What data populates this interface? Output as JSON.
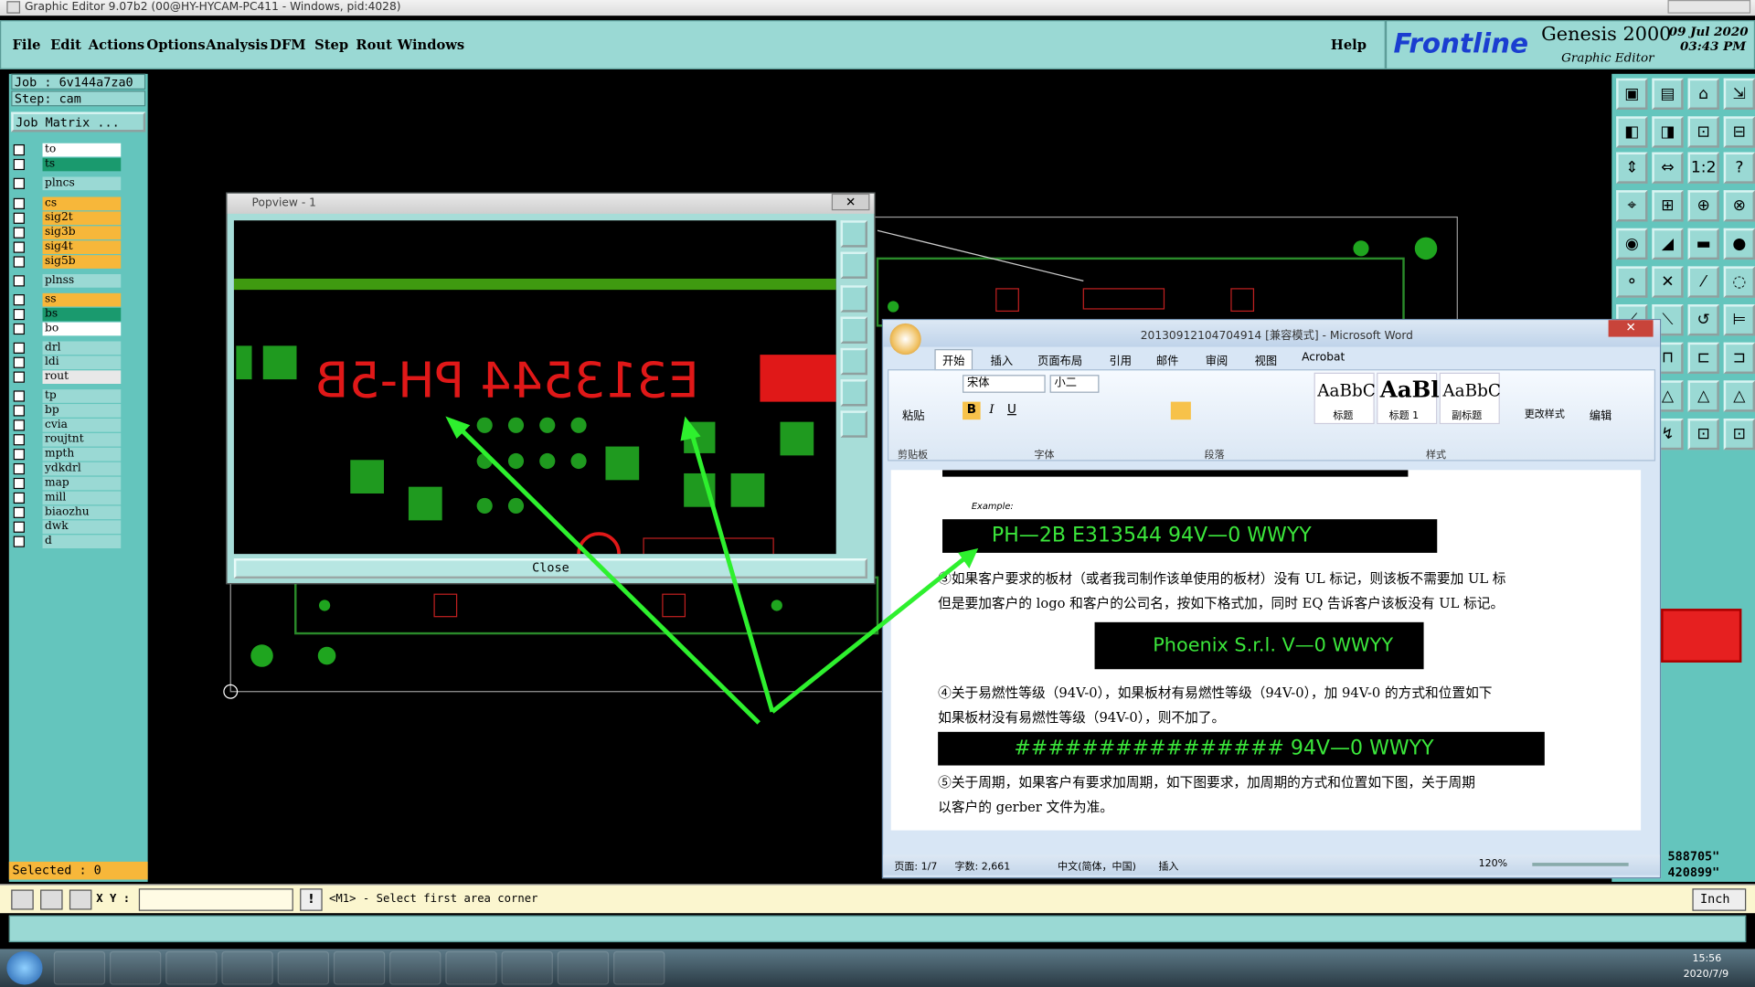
{
  "window": {
    "title": "Graphic Editor 9.07b2 (00@HY-HYCAM-PC411 - Windows, pid:4028)"
  },
  "menu": {
    "items": [
      "File",
      "Edit",
      "Actions",
      "Options",
      "Analysis",
      "DFM",
      "Step",
      "Rout",
      "Windows"
    ],
    "help": "Help"
  },
  "brand": {
    "logo": "Frontline",
    "product": "Genesis 2000",
    "subtitle": "Graphic Editor",
    "date": "09 Jul 2020",
    "time": "03:43 PM"
  },
  "job": {
    "job_line": "Job : 6v144a7za0",
    "step_line": "Step: cam",
    "matrix_button": "Job Matrix ..."
  },
  "layers": [
    {
      "name": "to",
      "color": "#ffffff"
    },
    {
      "name": "ts",
      "color": "#1a9a6e"
    },
    {
      "name": "plncs",
      "color": "#9ad9d4"
    },
    {
      "name": "cs",
      "color": "#f7b73a"
    },
    {
      "name": "sig2t",
      "color": "#f7b73a"
    },
    {
      "name": "sig3b",
      "color": "#f7b73a"
    },
    {
      "name": "sig4t",
      "color": "#f7b73a"
    },
    {
      "name": "sig5b",
      "color": "#f7b73a"
    },
    {
      "name": "plnss",
      "color": "#9ad9d4"
    },
    {
      "name": "ss",
      "color": "#f7b73a"
    },
    {
      "name": "bs",
      "color": "#1a9a6e"
    },
    {
      "name": "bo",
      "color": "#ffffff"
    },
    {
      "name": "drl",
      "color": "#9ad9d4"
    },
    {
      "name": "ldi",
      "color": "#9ad9d4"
    },
    {
      "name": "rout",
      "color": "#e8e8e8"
    },
    {
      "name": "tp",
      "color": "#9ad9d4"
    },
    {
      "name": "bp",
      "color": "#9ad9d4"
    },
    {
      "name": "cvia",
      "color": "#9ad9d4"
    },
    {
      "name": "roujtnt",
      "color": "#9ad9d4"
    },
    {
      "name": "mpth",
      "color": "#9ad9d4"
    },
    {
      "name": "ydkdrl",
      "color": "#9ad9d4"
    },
    {
      "name": "map",
      "color": "#9ad9d4"
    },
    {
      "name": "mill",
      "color": "#9ad9d4"
    },
    {
      "name": "biaozhu",
      "color": "#9ad9d4"
    },
    {
      "name": "dwk",
      "color": "#9ad9d4"
    },
    {
      "name": "d",
      "color": "#9ad9d4"
    }
  ],
  "selected": "Selected : 0",
  "status": {
    "xy_label": "X Y :",
    "prompt": "<M1> - Select first area corner",
    "unit": "Inch",
    "coord1": "588705\"",
    "coord2": "420899\""
  },
  "popview": {
    "title": "Popview - 1",
    "mirror_text": "E313544 PH-5B",
    "close": "Close"
  },
  "word": {
    "title": "20130912104704914 [兼容模式] - Microsoft Word",
    "tabs": [
      "开始",
      "插入",
      "页面布局",
      "引用",
      "邮件",
      "审阅",
      "视图",
      "Acrobat"
    ],
    "font_name": "宋体",
    "font_size": "小二",
    "groups": [
      "剪贴板",
      "字体",
      "段落",
      "样式",
      "编辑"
    ],
    "paste": "粘贴",
    "styles": [
      {
        "sample": "AaBbC",
        "label": "标题"
      },
      {
        "sample": "AaBl",
        "label": "标题 1"
      },
      {
        "sample": "AaBbC",
        "label": "副标题"
      }
    ],
    "change_styles": "更改样式",
    "edit": "编辑",
    "example_label": "Example:",
    "bar1": "PH—2B E313544  94V—0 WWYY",
    "para3a": "③如果客户要求的板材（或者我司制作该单使用的板材）没有 UL 标记，则该板不需要加 UL 标",
    "para3b": "但是要加客户的 logo 和客户的公司名，按如下格式加，同时 EQ 告诉客户该板没有 UL 标记。",
    "bar2": "Phoenix S.r.l. V—0 WWYY",
    "para4a": "④关于易燃性等级（94V-0），如果板材有易燃性等级（94V-0），加 94V-0 的方式和位置如下",
    "para4b": "如果板材没有易燃性等级（94V-0），则不加了。",
    "bar3": "################  94V—0 WWYY",
    "para5a": "⑤关于周期，如果客户有要求加周期，如下图要求，加周期的方式和位置如下图，关于周期",
    "para5b": "以客户的 gerber 文件为准。",
    "status_page": "页面: 1/7",
    "status_words": "字数: 2,661",
    "status_lang": "中文(简体，中国)",
    "status_mode": "插入",
    "zoom": "120%"
  },
  "taskbar": {
    "time": "15:56",
    "date": "2020/7/9"
  }
}
